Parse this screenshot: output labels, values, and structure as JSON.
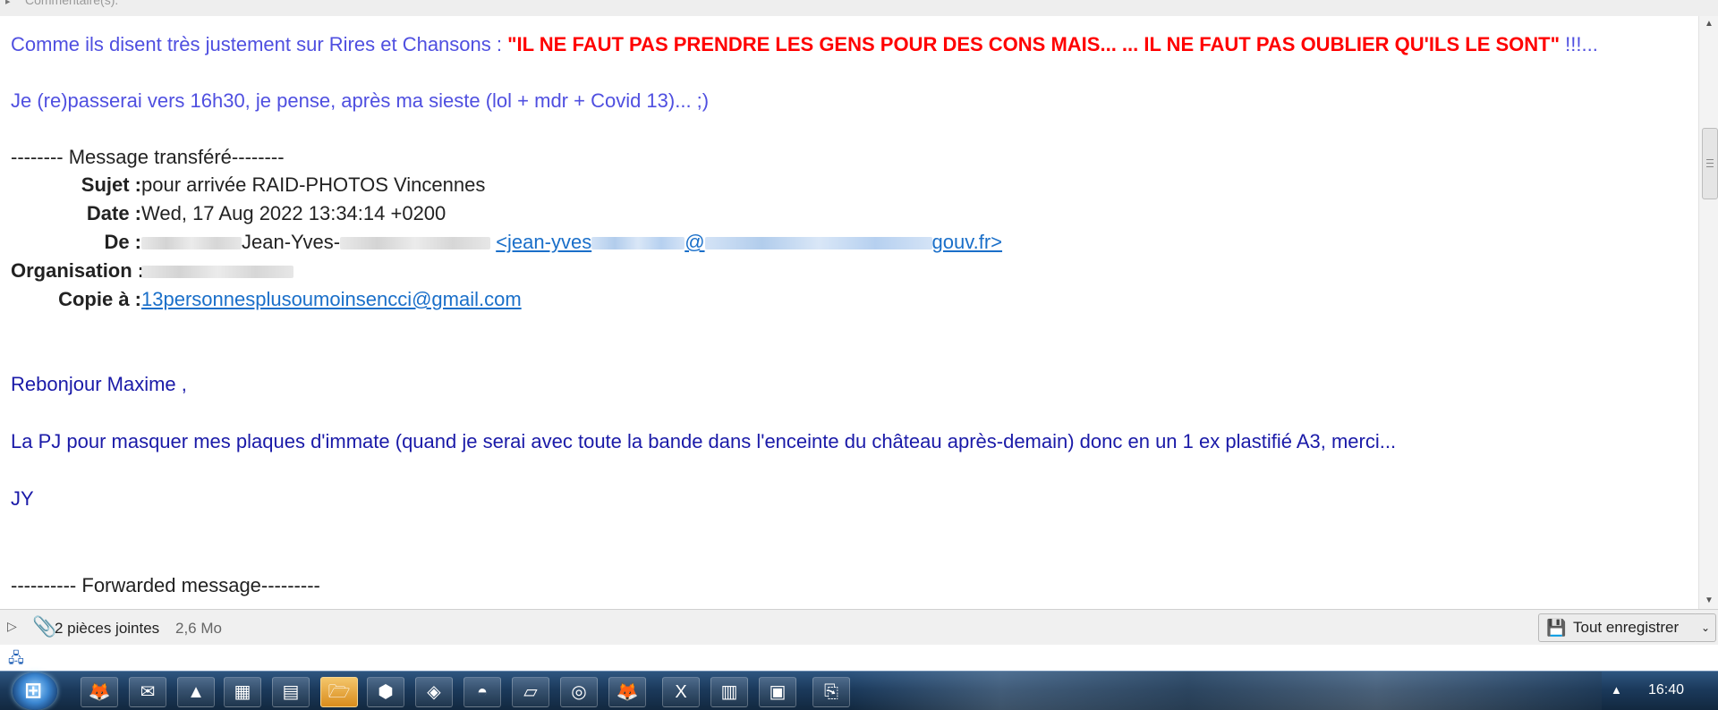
{
  "top_bar": {
    "label": "Commentaire(s)."
  },
  "message": {
    "intro_lead": "Comme ils disent très justement sur Rires et Chansons : ",
    "intro_quote": "\"IL NE FAUT PAS PRENDRE LES GENS POUR DES CONS MAIS... ... IL NE FAUT PAS OUBLIER QU'ILS LE SONT\"",
    "intro_tail": " !!!...",
    "line2": "Je (re)passerai vers 16h30, je pense, après ma sieste (lol + mdr + Covid 13)...     ;)",
    "forward_header": "-------- Message transféré--------",
    "headers": {
      "subject_label": "Sujet :",
      "subject": "pour arrivée RAID-PHOTOS Vincennes",
      "date_label": "Date :",
      "date": "Wed, 17 Aug 2022 13:34:14 +0200",
      "from_label": "De :",
      "from_name": "Jean-Yves-",
      "from_email_start": "<jean-yves",
      "from_email_at": "@",
      "from_email_end": "gouv.fr>",
      "org_label": "Organisation :",
      "cc_label": "Copie à :",
      "cc": "13personnesplusoumoinsencci@gmail.com"
    },
    "greeting": "Rebonjour Maxime ,",
    "body": "La PJ pour masquer mes plaques d'immate (quand je serai avec toute la bande dans l'enceinte du château après-demain) donc en un 1 ex plastifié A3, merci...",
    "signature": "JY",
    "forwarded": "---------- Forwarded message---------"
  },
  "attachments": {
    "count_label": "2 pièces jointes",
    "size": "2,6 Mo",
    "save_all_label": "Tout enregistrer"
  },
  "taskbar": {
    "clock": "16:40",
    "icons": [
      "firefox-icon",
      "thunderbird-icon",
      "vlc-icon",
      "photo-icon",
      "document-icon",
      "folder-icon",
      "app-shield-icon",
      "maps-icon",
      "hat-icon",
      "paper-icon",
      "globe-icon",
      "firefox-icon-2",
      "excel-icon",
      "sheet-icon",
      "window-icon",
      "pdf-icon"
    ]
  }
}
